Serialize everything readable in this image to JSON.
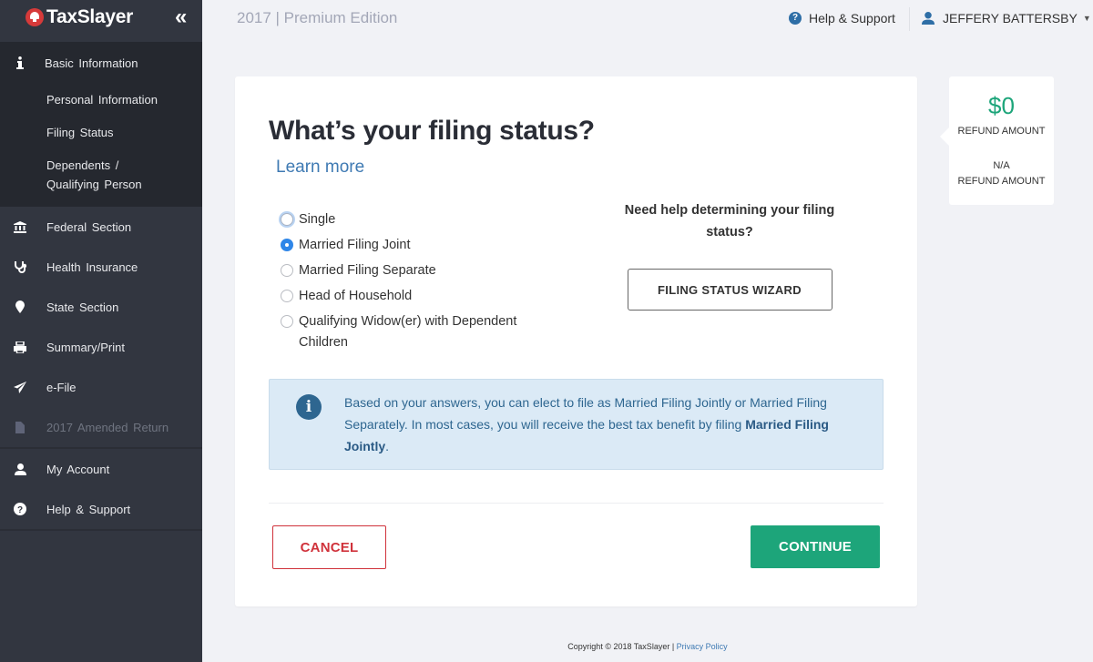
{
  "app": {
    "brand": "TaxSlayer",
    "edition": "2017 | Premium Edition",
    "colors": {
      "accent_green": "#1da57a",
      "cancel_red": "#d0323b",
      "link_blue": "#3f7ab3",
      "sidebar_bg": "#323640"
    }
  },
  "topbar": {
    "help_label": "Help & Support",
    "user_name": "JEFFERY BATTERSBY"
  },
  "sidebar": {
    "collapse_label": "«",
    "active_section": {
      "label": "Basic Information",
      "icon": "info-icon",
      "subitems": [
        {
          "label": "Personal Information"
        },
        {
          "label": "Filing Status"
        },
        {
          "label": "Dependents / Qualifying Person"
        }
      ]
    },
    "items": [
      {
        "label": "Federal Section",
        "icon": "bank-icon"
      },
      {
        "label": "Health Insurance",
        "icon": "stethoscope-icon"
      },
      {
        "label": "State Section",
        "icon": "map-marker-icon"
      },
      {
        "label": "Summary/Print",
        "icon": "print-icon"
      },
      {
        "label": "e-File",
        "icon": "paper-plane-icon"
      },
      {
        "label": "2017 Amended Return",
        "icon": "file-icon",
        "disabled": true
      }
    ],
    "bottom_items": [
      {
        "label": "My Account",
        "icon": "user-icon"
      },
      {
        "label": "Help & Support",
        "icon": "question-circle-icon"
      }
    ]
  },
  "main": {
    "title": "What’s your filing status?",
    "learn_more": "Learn more",
    "options": [
      {
        "label": "Single",
        "checked": false
      },
      {
        "label": "Married Filing Joint",
        "checked": true
      },
      {
        "label": "Married Filing Separate",
        "checked": false
      },
      {
        "label": "Head of Household",
        "checked": false
      },
      {
        "label": "Qualifying Widow(er) with Dependent Children",
        "checked": false
      }
    ],
    "help_question": "Need help determining your filing status?",
    "wizard_button": "FILING STATUS WIZARD",
    "info": {
      "text": "Based on your answers, you can elect to file as Married Filing Jointly or Married Filing Separately. In most cases, you will receive the best tax benefit by filing ",
      "bold": "Married Filing Jointly",
      "end": "."
    },
    "cancel_button": "CANCEL",
    "continue_button": "CONTINUE"
  },
  "refund": {
    "federal_amount": "$0",
    "federal_label": "REFUND AMOUNT",
    "state_amount": "N/A",
    "state_label": "REFUND AMOUNT"
  },
  "footer": {
    "copyright": "Copyright © 2018 TaxSlayer | ",
    "privacy": "Privacy Policy"
  }
}
